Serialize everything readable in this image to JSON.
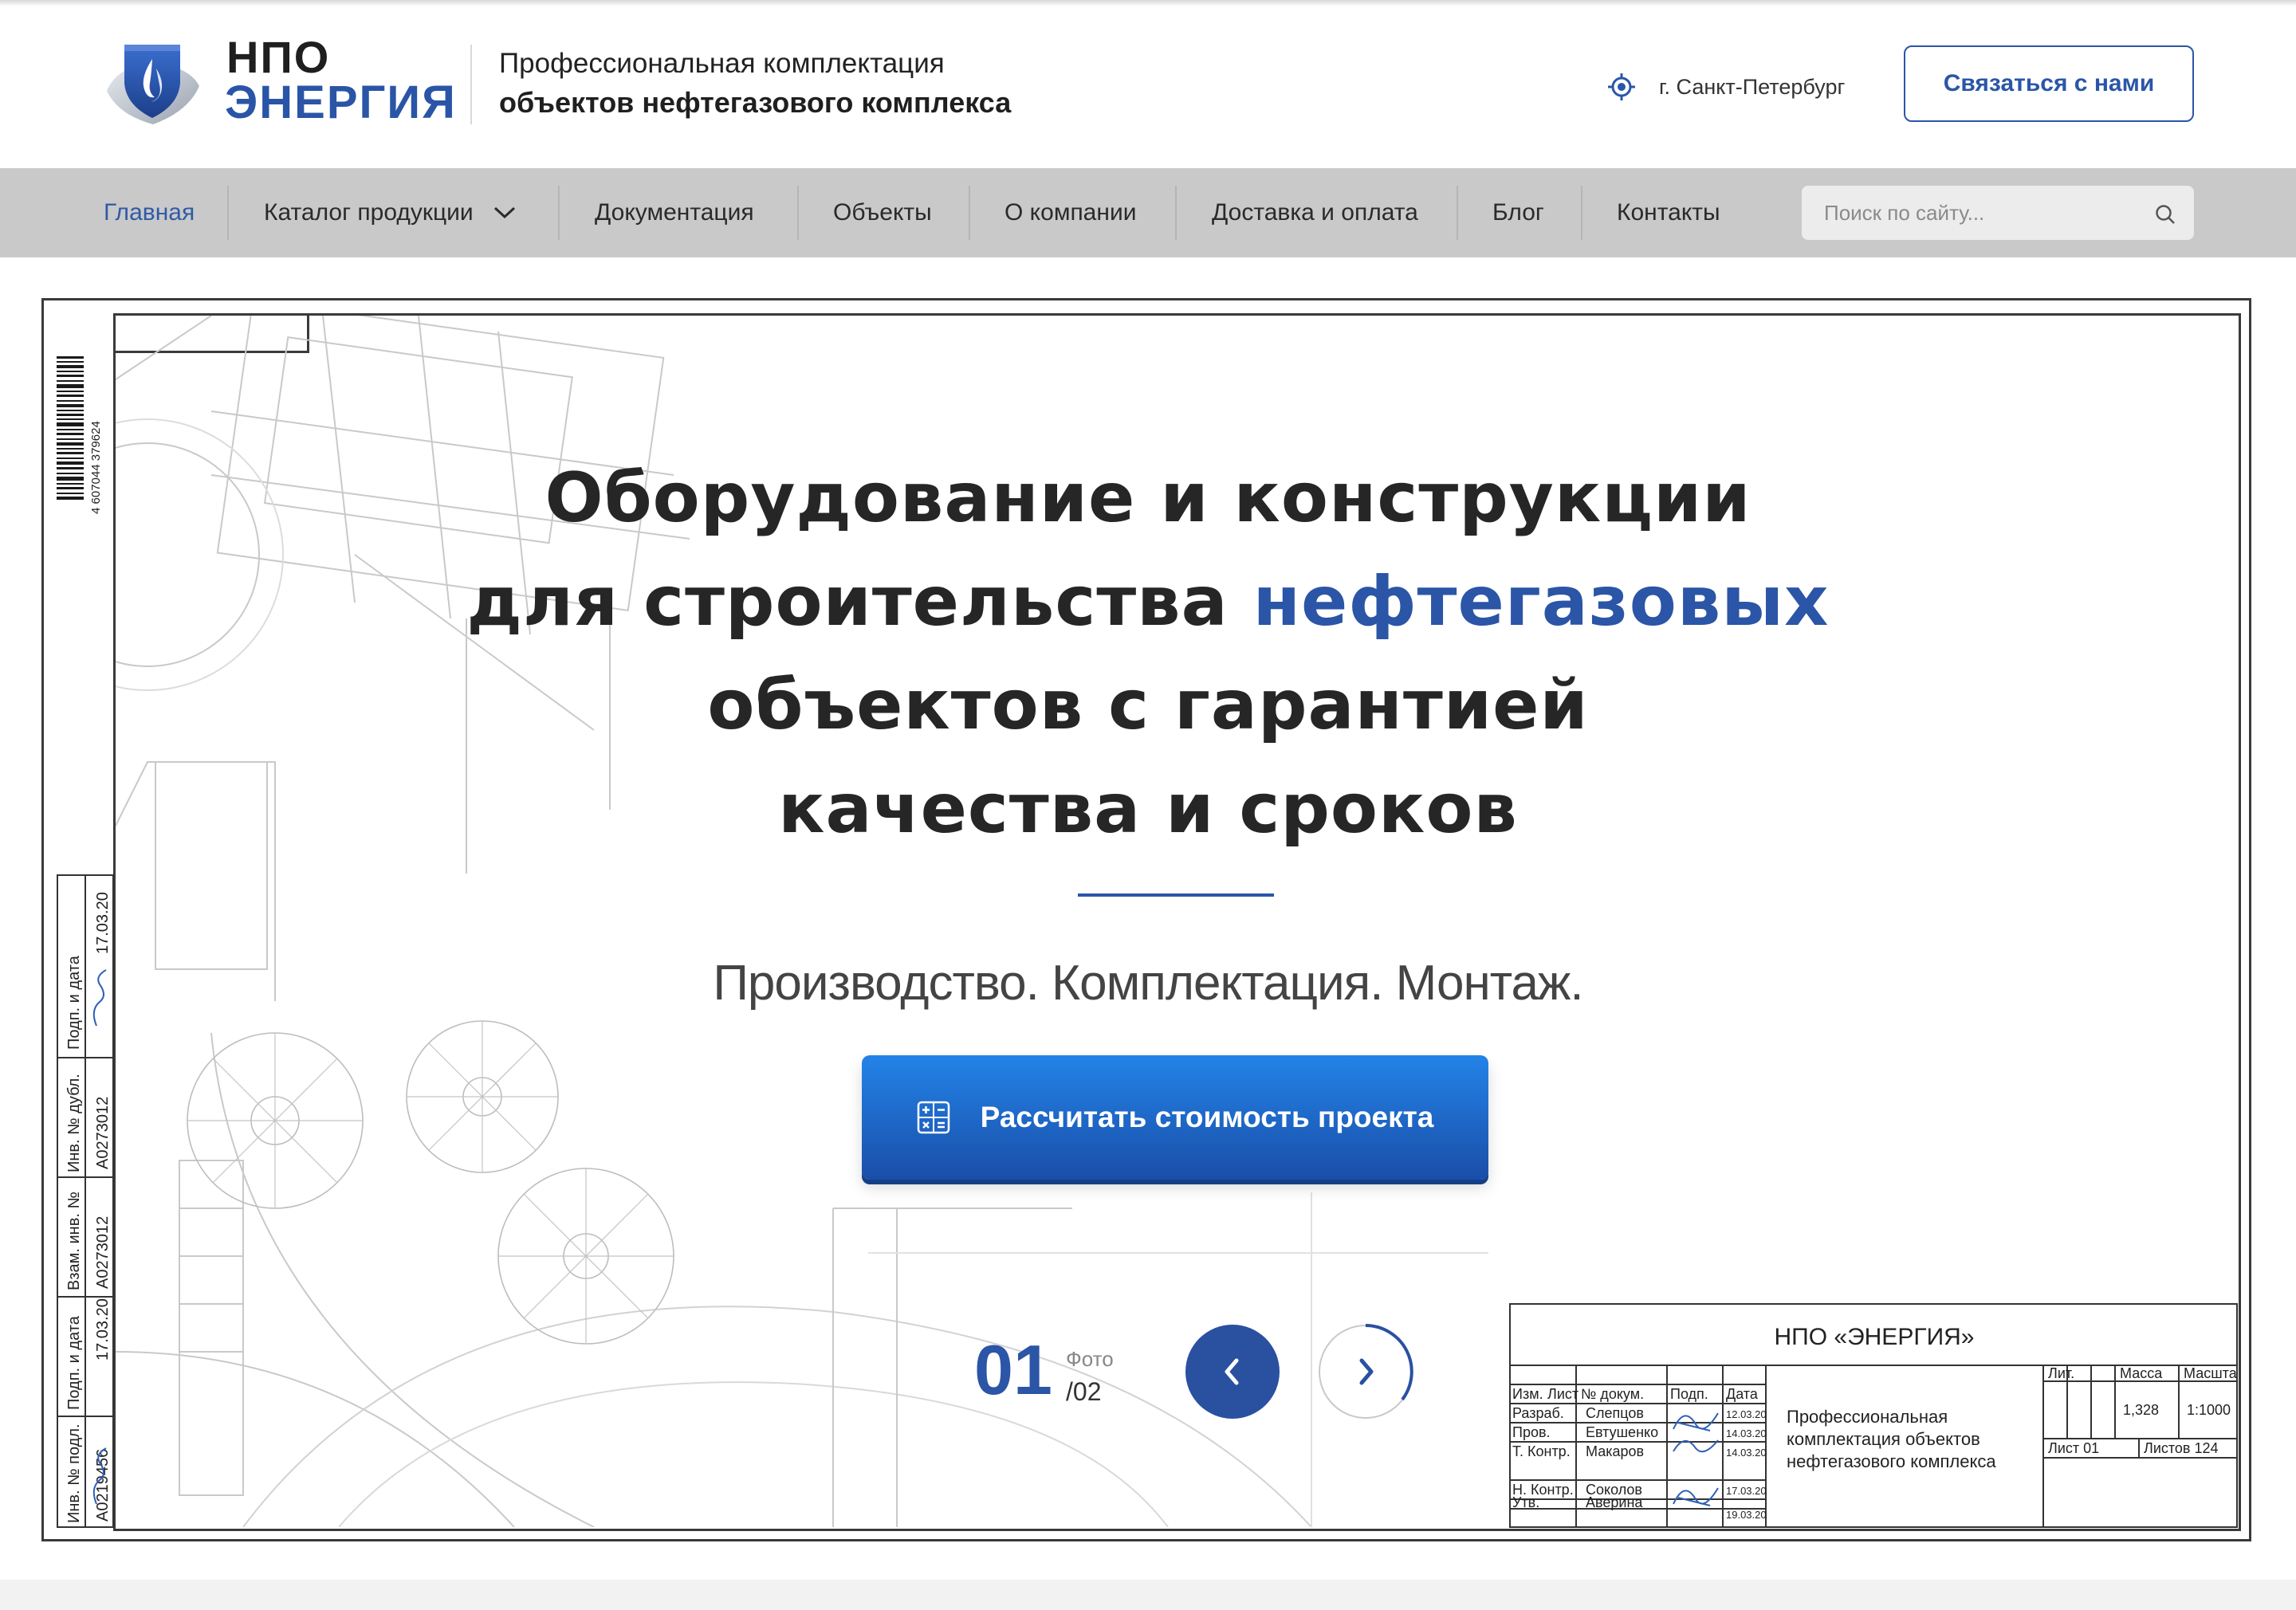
{
  "brand": {
    "name_line1": "НПО",
    "name_line2": "ЭНЕРГИЯ",
    "tagline_line1": "Профессиональная комплектация",
    "tagline_line2": "объектов нефтегазового комплекса",
    "color": "#2a55a7"
  },
  "header": {
    "city": "г. Санкт-Петербург",
    "city_icon": "location-target-icon",
    "contact_button": "Связаться с нами"
  },
  "nav": {
    "items": [
      {
        "label": "Главная",
        "active": true
      },
      {
        "label": "Каталог продукции",
        "has_dropdown": true
      },
      {
        "label": "Документация"
      },
      {
        "label": "Объекты"
      },
      {
        "label": "О компании"
      },
      {
        "label": "Доставка и оплата"
      },
      {
        "label": "Блог"
      },
      {
        "label": "Контакты"
      }
    ],
    "search_placeholder": "Поиск по сайту...",
    "search_icon": "search-icon"
  },
  "hero": {
    "title_line1": "Оборудование и конструкции",
    "title_line2_pre": "для строительства ",
    "title_line2_highlight": "нефтегазовых",
    "title_line3": "объектов с гарантией",
    "title_line4": "качества и сроков",
    "subtitle": "Производство. Комплектация. Монтаж.",
    "cta_label": "Рассчитать стоимость проекта",
    "cta_icon": "calculator-icon",
    "slider": {
      "current": "01",
      "word": "Фото",
      "total": "/02",
      "prev_icon": "chevron-left-icon",
      "next_icon": "chevron-right-icon"
    }
  },
  "drawing": {
    "barcode_number": "4 607044 379624",
    "left_strip": {
      "labels": [
        "Инв. № подл.",
        "Подп. и дата",
        "Взам. инв. №",
        "Инв. № дубл.",
        "Подп. и дата"
      ],
      "values": [
        "A0219456",
        "17.03.20",
        "A0273012",
        "A0273012",
        "17.03.20"
      ]
    },
    "stamp": {
      "org": "НПО «ЭНЕРГИЯ»",
      "headers": [
        "Изм.",
        "Лист",
        "№ докум.",
        "Подп.",
        "Дата"
      ],
      "rows": [
        {
          "role": "Разраб.",
          "name": "Слепцов",
          "date": "12.03.20"
        },
        {
          "role": "Пров.",
          "name": "Евтушенко",
          "date": "14.03.20"
        },
        {
          "role": "Т. Контр.",
          "name": "Макаров",
          "date": "14.03.20"
        },
        {
          "role": "",
          "name": "",
          "date": ""
        },
        {
          "role": "Н. Контр.",
          "name": "Соколов",
          "date": "17.03.20"
        },
        {
          "role": "Утв.",
          "name": "Аверина",
          "date": "19.03.20"
        }
      ],
      "description": [
        "Профессиональная",
        "комплектация объектов",
        "нефтегазового комплекса"
      ],
      "lit_label": "Лит.",
      "mass_label": "Масса",
      "scale_label": "Масштаб",
      "mass": "1,328",
      "scale": "1:1000",
      "sheet": "Лист 01",
      "sheets": "Листов 124"
    }
  }
}
